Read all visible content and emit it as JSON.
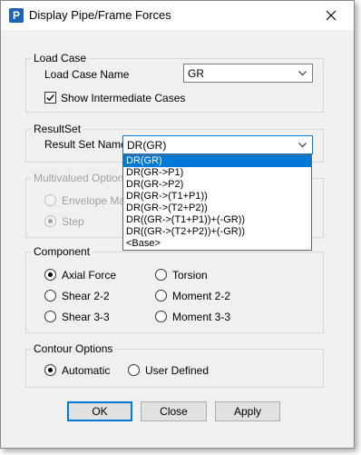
{
  "window": {
    "title": "Display Pipe/Frame Forces",
    "icon_letter": "P",
    "close_icon": "close-icon"
  },
  "load_case": {
    "legend": "Load Case",
    "name_label": "Load Case Name",
    "name_value": "GR",
    "show_intermediate_label": "Show Intermediate Cases",
    "show_intermediate_checked": true
  },
  "result_set": {
    "legend": "ResultSet",
    "name_label": "Result Set Name",
    "name_value": "DR(GR)",
    "options": [
      "DR(GR)",
      "DR(GR->P1)",
      "DR(GR->P2)",
      "DR(GR->(T1+P1))",
      "DR(GR->(T2+P2))",
      "DR((GR->(T1+P1))+(-GR))",
      "DR((GR->(T2+P2))+(-GR))",
      "<Base>"
    ],
    "selected_index": 0
  },
  "multivalued": {
    "legend": "Multivalued Options",
    "envelope_label": "Envelope Max",
    "step_label": "Step",
    "selected": "step",
    "enabled": false
  },
  "component": {
    "legend": "Component",
    "options": [
      {
        "label": "Axial Force",
        "selected": true
      },
      {
        "label": "Shear 2-2",
        "selected": false
      },
      {
        "label": "Shear 3-3",
        "selected": false
      },
      {
        "label": "Torsion",
        "selected": false
      },
      {
        "label": "Moment 2-2",
        "selected": false
      },
      {
        "label": "Moment 3-3",
        "selected": false
      }
    ]
  },
  "contour": {
    "legend": "Contour Options",
    "automatic_label": "Automatic",
    "user_defined_label": "User Defined",
    "selected": "automatic"
  },
  "buttons": {
    "ok": "OK",
    "close": "Close",
    "apply": "Apply"
  },
  "colors": {
    "accent": "#0078d7",
    "dialog_bg": "#f0f0f0",
    "disabled_text": "#a0a0a0"
  }
}
